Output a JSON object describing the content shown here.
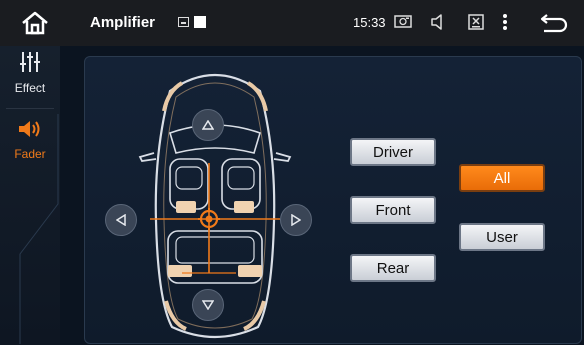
{
  "statusbar": {
    "title": "Amplifier",
    "time": "15:33",
    "icons": [
      "home-icon",
      "image-icon",
      "square-icon",
      "camera-icon",
      "volume-icon",
      "close-box-icon",
      "more-vert-icon",
      "back-icon"
    ]
  },
  "sidebar": {
    "items": [
      {
        "label": "Effect",
        "icon": "equalizer-icon",
        "active": false
      },
      {
        "label": "Fader",
        "icon": "speaker-icon",
        "active": true
      }
    ]
  },
  "fader": {
    "arrows": [
      "up",
      "down",
      "left",
      "right"
    ],
    "buttons": {
      "driver": "Driver",
      "front": "Front",
      "rear": "Rear",
      "all": "All",
      "user": "User"
    },
    "selected": "All",
    "accent_color": "#f07a1a"
  }
}
